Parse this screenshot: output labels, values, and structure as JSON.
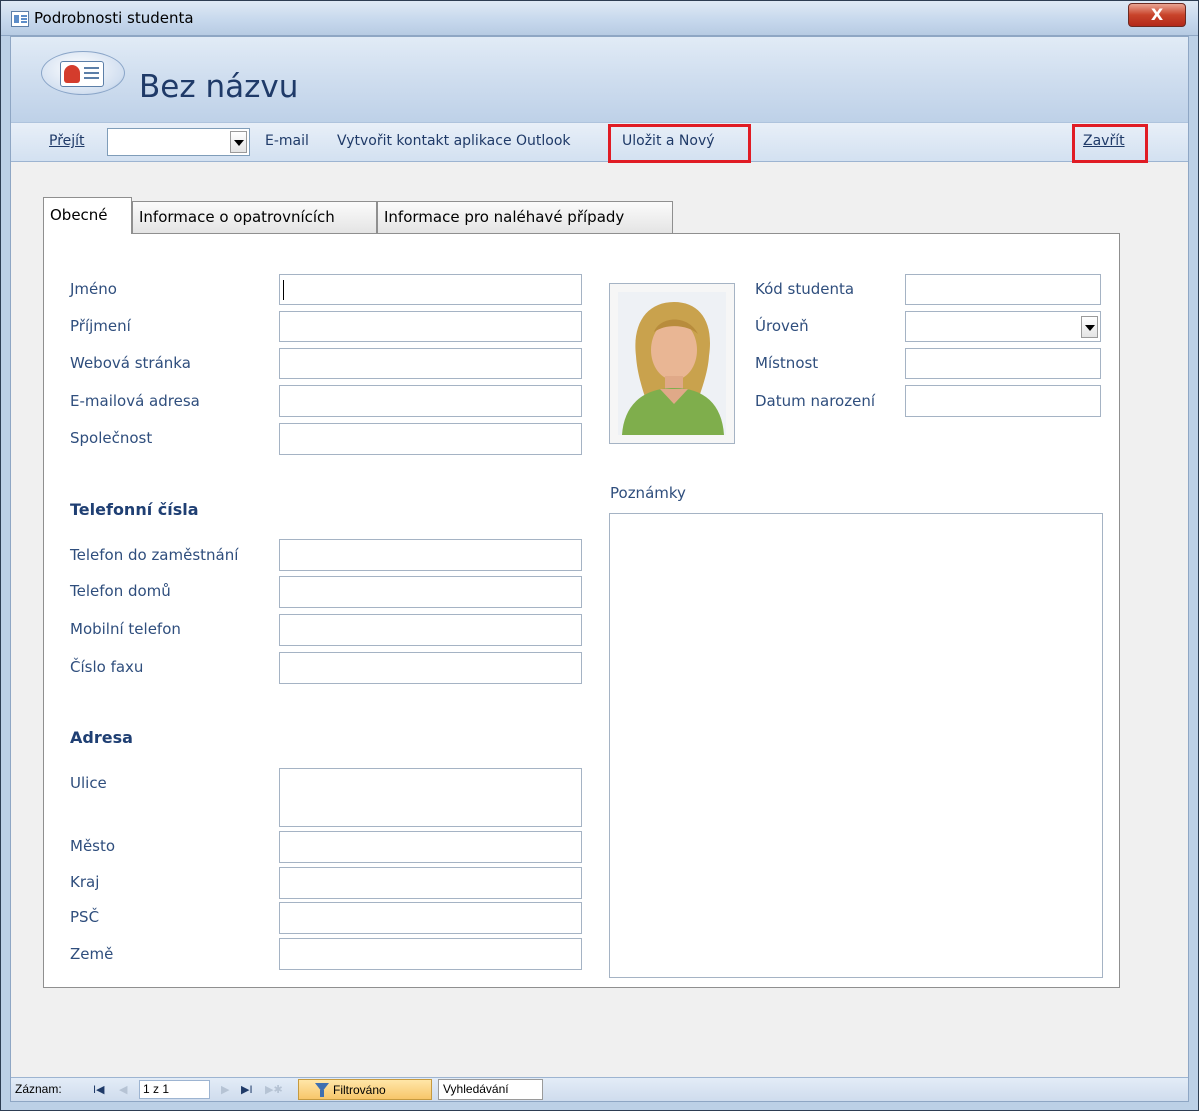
{
  "window": {
    "title": "Podrobnosti studenta",
    "close_label": "X"
  },
  "header": {
    "record_title": "Bez názvu"
  },
  "toolbar": {
    "goto_label": "Přejít",
    "goto_value": "",
    "email_label": "E-mail",
    "outlook_label": "Vytvořit kontakt aplikace Outlook",
    "save_new_label": "Uložit a Nový",
    "close_label": "Zavřít"
  },
  "tabs": [
    {
      "label": "Obecné",
      "active": true
    },
    {
      "label": "Informace o opatrovnících",
      "active": false
    },
    {
      "label": "Informace pro naléhavé případy",
      "active": false
    }
  ],
  "general": {
    "first_name": {
      "label": "Jméno",
      "value": ""
    },
    "last_name": {
      "label": "Příjmení",
      "value": ""
    },
    "web_page": {
      "label": "Webová stránka",
      "value": ""
    },
    "email": {
      "label": "E-mailová adresa",
      "value": ""
    },
    "company": {
      "label": "Společnost",
      "value": ""
    },
    "phones_heading": "Telefonní čísla",
    "business_phone": {
      "label": "Telefon do zaměstnání",
      "value": ""
    },
    "home_phone": {
      "label": "Telefon domů",
      "value": ""
    },
    "mobile_phone": {
      "label": "Mobilní telefon",
      "value": ""
    },
    "fax_number": {
      "label": "Číslo faxu",
      "value": ""
    },
    "address_heading": "Adresa",
    "street": {
      "label": "Ulice",
      "value": ""
    },
    "city": {
      "label": "Město",
      "value": ""
    },
    "state": {
      "label": "Kraj",
      "value": ""
    },
    "zip": {
      "label": "PSČ",
      "value": ""
    },
    "country": {
      "label": "Země",
      "value": ""
    },
    "student_id": {
      "label": "Kód studenta",
      "value": ""
    },
    "level": {
      "label": "Úroveň",
      "value": ""
    },
    "room": {
      "label": "Místnost",
      "value": ""
    },
    "birth_date": {
      "label": "Datum narození",
      "value": ""
    },
    "notes": {
      "label": "Poznámky",
      "value": ""
    }
  },
  "status": {
    "record_label": "Záznam:",
    "record_position": "1 z 1",
    "filter_label": "Filtrováno",
    "search_label": "Vyhledávání"
  },
  "colors": {
    "label_text": "#2f4e7d",
    "highlight": "#e01b24",
    "filter_bg": "#f7c66a"
  }
}
